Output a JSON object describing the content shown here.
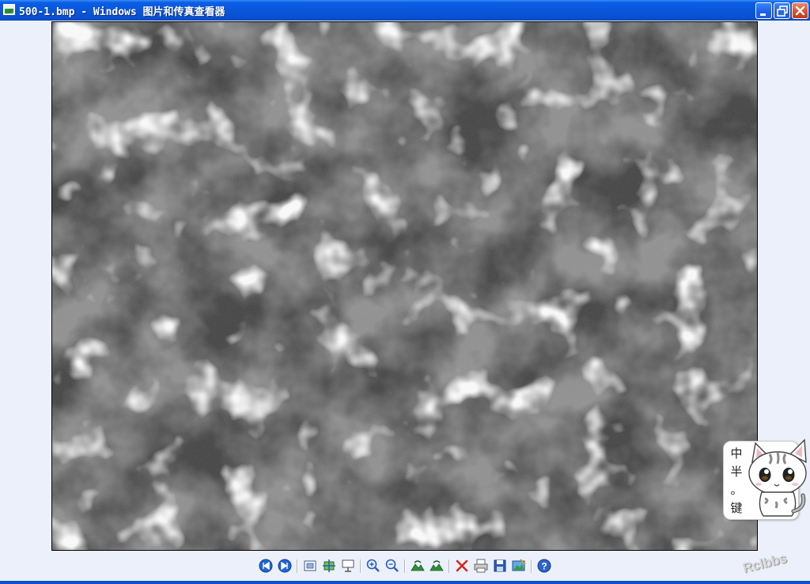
{
  "window": {
    "title": "500-1.bmp - Windows 图片和传真查看器",
    "controls": {
      "minimize": "minimize",
      "restore": "restore",
      "close": "close"
    }
  },
  "viewer": {
    "image_description_icon": "photo-icon"
  },
  "toolbar": {
    "buttons": [
      {
        "name": "previous-image-button",
        "icon": "previous-icon",
        "tooltip": ""
      },
      {
        "name": "next-image-button",
        "icon": "next-icon"
      },
      {
        "name": "best-fit-button",
        "icon": "best-fit-icon"
      },
      {
        "name": "actual-size-button",
        "icon": "actual-size-icon"
      },
      {
        "name": "slideshow-button",
        "icon": "slideshow-icon"
      },
      {
        "name": "zoom-in-button",
        "icon": "zoom-in-icon"
      },
      {
        "name": "zoom-out-button",
        "icon": "zoom-out-icon"
      },
      {
        "name": "rotate-clockwise-button",
        "icon": "rotate-clockwise-icon"
      },
      {
        "name": "rotate-counterclockwise-button",
        "icon": "rotate-counterclockwise-icon"
      },
      {
        "name": "delete-button",
        "icon": "delete-icon"
      },
      {
        "name": "print-button",
        "icon": "print-icon"
      },
      {
        "name": "save-button",
        "icon": "save-icon"
      },
      {
        "name": "open-editor-button",
        "icon": "edit-icon"
      },
      {
        "name": "help-button",
        "icon": "help-icon"
      }
    ]
  },
  "sticker": {
    "chars": [
      "中",
      "半",
      "。",
      "键"
    ]
  },
  "watermark": {
    "text": "Rclbbs"
  },
  "colors": {
    "titlebar": "#0a55d8",
    "client_background": "#ebf0fa",
    "image_frame_border": "#000000"
  }
}
